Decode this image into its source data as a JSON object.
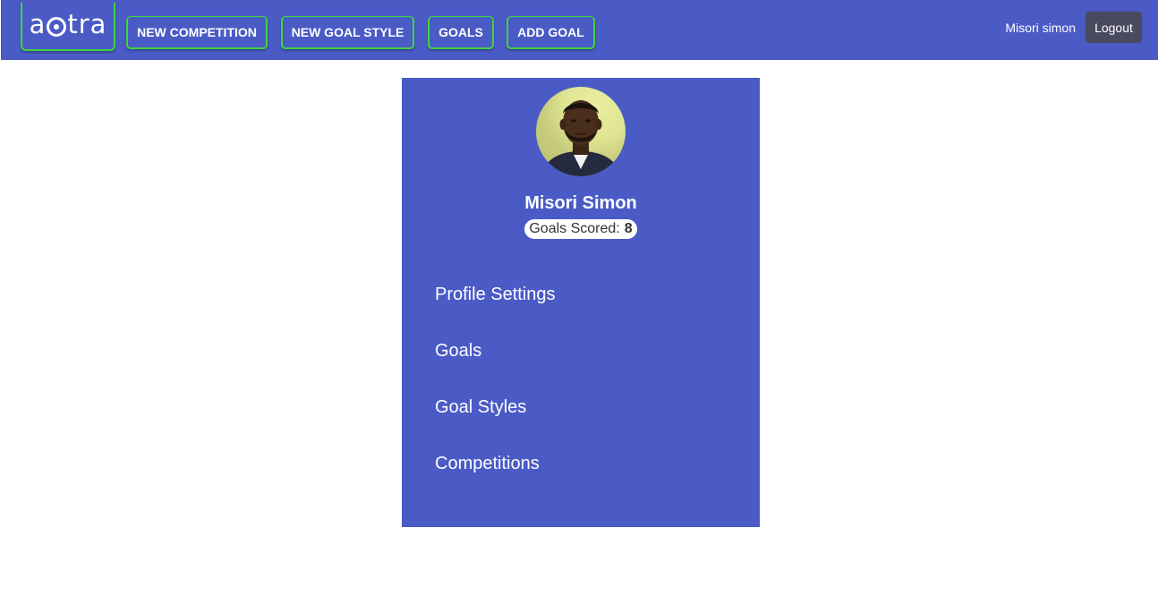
{
  "navbar": {
    "logo_text_a": "a",
    "logo_text_b": "tra",
    "logo_alt": "aotra",
    "buttons": [
      {
        "label": "NEW COMPETITION"
      },
      {
        "label": "NEW GOAL STYLE"
      },
      {
        "label": "GOALS"
      },
      {
        "label": "ADD GOAL"
      }
    ],
    "user_name": "Misori simon",
    "logout_label": "Logout"
  },
  "profile": {
    "name": "Misori Simon",
    "goals_scored_label": "Goals Scored:",
    "goals_scored_value": "8",
    "avatar_icon": "user-photo"
  },
  "menu": {
    "items": [
      {
        "label": "Profile Settings"
      },
      {
        "label": "Goals"
      },
      {
        "label": "Goal Styles"
      },
      {
        "label": "Competitions"
      }
    ]
  },
  "colors": {
    "primary": "#4a5bc6",
    "nav_border": "#3fd43f",
    "logout_bg": "#4a4a5e"
  }
}
